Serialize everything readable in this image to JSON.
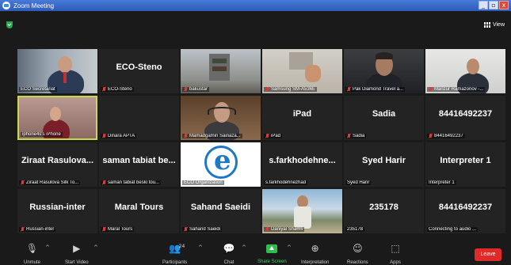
{
  "window": {
    "title": "Zoom Meeting",
    "buttons": [
      "_",
      "▫",
      "x"
    ]
  },
  "topbar": {
    "view_label": "View"
  },
  "tiles": [
    {
      "label": "ECO Secretariat",
      "big": "",
      "muted": false
    },
    {
      "label": "ECO-Steno",
      "big": "ECO-Steno",
      "muted": true
    },
    {
      "label": "bakustar",
      "big": "",
      "muted": true
    },
    {
      "label": "Samsung SM-A536E",
      "big": "",
      "muted": true
    },
    {
      "label": "Pak Diamond Travel a...",
      "big": "",
      "muted": true
    },
    {
      "label": "Manzur Ramazonov -...",
      "big": "",
      "muted": true
    },
    {
      "label": "iphone4s's iPhone",
      "big": "",
      "muted": false
    },
    {
      "label": "Dinara APTA",
      "big": "",
      "muted": true
    },
    {
      "label": "Mamadgamin Sainaza...",
      "big": "",
      "muted": true
    },
    {
      "label": "iPad",
      "big": "iPad",
      "muted": true
    },
    {
      "label": "Sadia",
      "big": "Sadia",
      "muted": true
    },
    {
      "label": "84416492237",
      "big": "84416492237",
      "muted": true
    },
    {
      "label": "Ziraat Rasulova Silk To...",
      "big": "Ziraat Rasulova...",
      "muted": true
    },
    {
      "label": "saman tabiat beski tou...",
      "big": "saman tabiat be...",
      "muted": true
    },
    {
      "label": "ECO Organization",
      "big": "",
      "muted": false
    },
    {
      "label": "s.farkhodehnezhad",
      "big": "s.farkhodehne...",
      "muted": false
    },
    {
      "label": "Syed Harir",
      "big": "Syed Harir",
      "muted": false
    },
    {
      "label": "Interpreter 1",
      "big": "Interpreter 1",
      "muted": false
    },
    {
      "label": "Russian-inter",
      "big": "Russian-inter",
      "muted": true
    },
    {
      "label": "Maral Tours",
      "big": "Maral Tours",
      "muted": true
    },
    {
      "label": "Sahand Saeidi",
      "big": "Sahand Saeidi",
      "muted": true
    },
    {
      "label": "Daniyal Shams",
      "big": "",
      "muted": true
    },
    {
      "label": "235178",
      "big": "235178",
      "muted": false
    },
    {
      "label": "Connecting to audio ...",
      "big": "84416492237",
      "muted": false
    }
  ],
  "toolbar": {
    "unmute": "Unmute",
    "start_video": "Start Video",
    "participants": "Participants",
    "participants_count": "24",
    "chat": "Chat",
    "share_screen": "Share Screen",
    "interpretation": "Interpretation",
    "reactions": "Reactions",
    "apps": "Apps",
    "leave": "Leave"
  },
  "colors": {
    "active_speaker": "#c9d94a",
    "leave": "#e02a2a",
    "share": "#2fbd4f"
  }
}
